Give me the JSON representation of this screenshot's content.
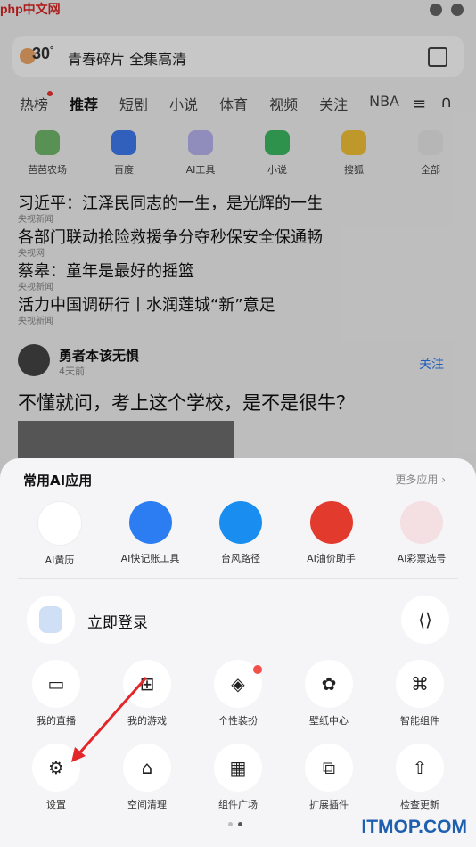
{
  "status": {
    "watermark": "php中文网"
  },
  "search": {
    "temperature": "30",
    "unit": "°",
    "query": "青春碎片 全集高清"
  },
  "tabs": [
    "热榜",
    "推荐",
    "短剧",
    "小说",
    "体育",
    "视频",
    "关注",
    "NBA"
  ],
  "apps": [
    {
      "label": "芭芭农场",
      "color": "#73b96b"
    },
    {
      "label": "百度",
      "color": "#3e7cf0"
    },
    {
      "label": "AI工具",
      "color": "#b9b4f0"
    },
    {
      "label": "小说",
      "color": "#3dbb62"
    },
    {
      "label": "搜狐",
      "color": "#f5c338"
    },
    {
      "label": "全部",
      "color": "#e9e9e9"
    }
  ],
  "news": [
    {
      "title": "习近平：江泽民同志的一生，是光辉的一生",
      "source": "央视新闻"
    },
    {
      "title": "各部门联动抢险救援争分夺秒保安全保通畅",
      "source": "央视网"
    },
    {
      "title": "蔡皋：童年是最好的摇篮",
      "source": "央视新闻"
    },
    {
      "title": "活力中国调研行丨水润莲城“新”意足",
      "source": "央视新闻"
    }
  ],
  "author": {
    "name": "勇者本该无惧",
    "time": "4天前",
    "follow": "关注"
  },
  "headline": "不懂就问，考上这个学校，是不是很牛？",
  "sheet": {
    "title": "常用AI应用",
    "more": "更多应用",
    "ai_apps": [
      {
        "label": "AI黄历",
        "color": "#ffffff"
      },
      {
        "label": "AI快记账工具",
        "color": "#2d7df2"
      },
      {
        "label": "台风路径",
        "color": "#1a8ef0"
      },
      {
        "label": "AI油价助手",
        "color": "#e23b2d"
      },
      {
        "label": "AI彩票选号",
        "color": "#f4dfe2"
      }
    ],
    "login": "立即登录",
    "grid": [
      [
        {
          "label": "我的直播",
          "icon": "live-icon",
          "glyph": "▭"
        },
        {
          "label": "我的游戏",
          "icon": "game-icon",
          "glyph": "⊞"
        },
        {
          "label": "个性装扮",
          "icon": "skin-icon",
          "glyph": "◈"
        },
        {
          "label": "壁纸中心",
          "icon": "wallpaper-icon",
          "glyph": "✿"
        },
        {
          "label": "智能组件",
          "icon": "widget-icon",
          "glyph": "⌘"
        }
      ],
      [
        {
          "label": "设置",
          "icon": "settings-icon",
          "glyph": "⚙"
        },
        {
          "label": "空间清理",
          "icon": "broom-icon",
          "glyph": "⌂"
        },
        {
          "label": "组件广场",
          "icon": "components-icon",
          "glyph": "▦"
        },
        {
          "label": "扩展插件",
          "icon": "plugin-icon",
          "glyph": "⧉"
        },
        {
          "label": "检查更新",
          "icon": "update-icon",
          "glyph": "⇧"
        }
      ]
    ]
  },
  "footer_watermark": "ITMOP.COM"
}
